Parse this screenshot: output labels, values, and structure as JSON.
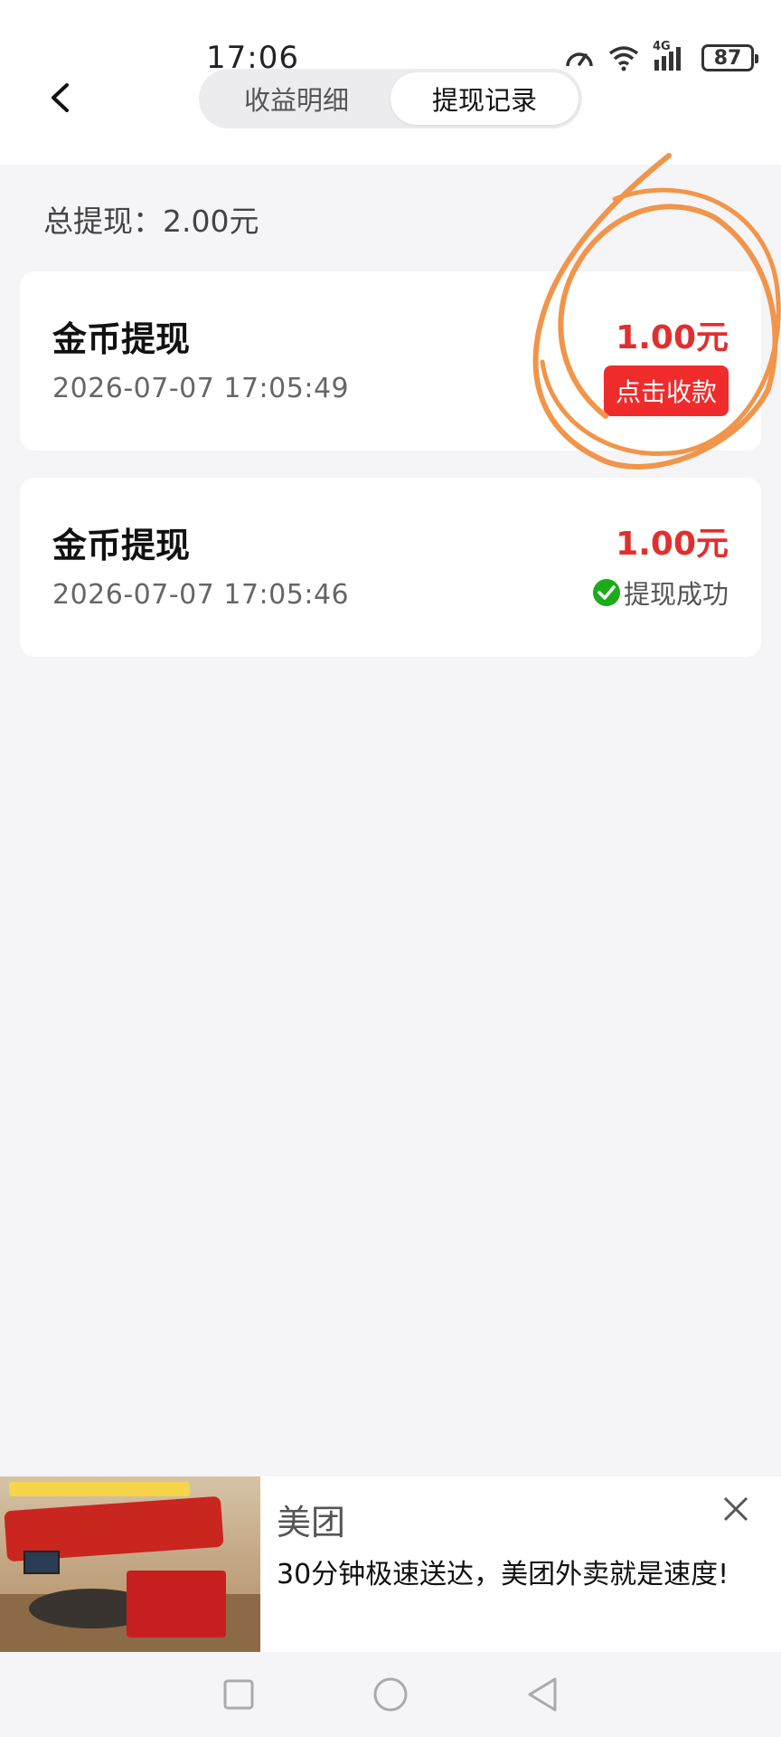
{
  "status_bar": {
    "time": "17:06",
    "battery": "87",
    "network": "4G",
    "icons": [
      "speed-icon",
      "wifi-icon",
      "signal-icon",
      "battery-icon"
    ]
  },
  "header": {
    "back_icon": "chevron-left-icon",
    "tabs": [
      {
        "label": "收益明细",
        "active": false
      },
      {
        "label": "提现记录",
        "active": true
      }
    ]
  },
  "summary": {
    "total_withdrawal": "总提现：2.00元"
  },
  "records": [
    {
      "title": "金币提现",
      "time": "2026-07-07 17:05:49",
      "amount": "1.00元",
      "action_label": "点击收款"
    },
    {
      "title": "金币提现",
      "time": "2026-07-07 17:05:46",
      "amount": "1.00元",
      "status_label": "提现成功",
      "status_icon": "check-circle-icon"
    }
  ],
  "ad": {
    "brand": "美团",
    "description": "30分钟极速送达，美团外卖就是速度!",
    "close_icon": "close-icon"
  },
  "colors": {
    "accent_red": "#e02f2f",
    "button_red": "#f02b2b",
    "success_green": "#1aad19",
    "annotation_orange": "#f0954a"
  }
}
